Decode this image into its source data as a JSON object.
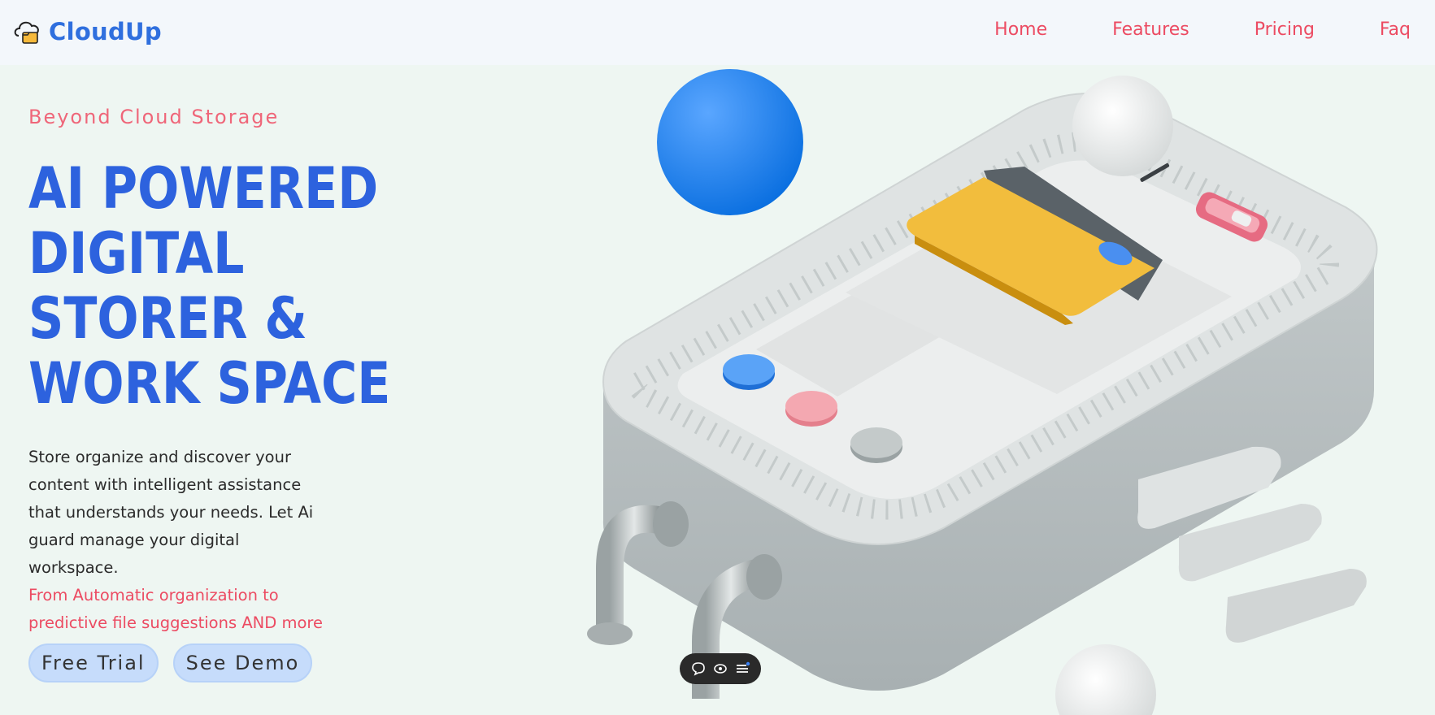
{
  "brand": {
    "name": "CloudUp",
    "logo_icon": "cloud-folder-icon"
  },
  "nav": {
    "items": [
      "Home",
      "Features",
      "Pricing",
      "Faq"
    ]
  },
  "hero": {
    "eyebrow": "Beyond Cloud Storage",
    "headline_lines": [
      "AI POWERED",
      "DIGITAL",
      "STORER &",
      "WORK SPACE"
    ],
    "description": "Store organize and discover your content with intelligent assistance that understands your needs. Let Ai guard manage your digital workspace.",
    "highlight": "From Automatic organization to predictive file suggestions AND more",
    "buttons": {
      "primary": "Free Trial",
      "secondary": "See Demo"
    }
  },
  "floating_toolbar": {
    "icons": [
      "comment-icon",
      "eye-icon",
      "menu-icon"
    ]
  },
  "colors": {
    "brand_blue": "#2f6fde",
    "accent_pink": "#ec4b62",
    "button_bg": "#c6dcfb",
    "background": "#eef6f2"
  }
}
